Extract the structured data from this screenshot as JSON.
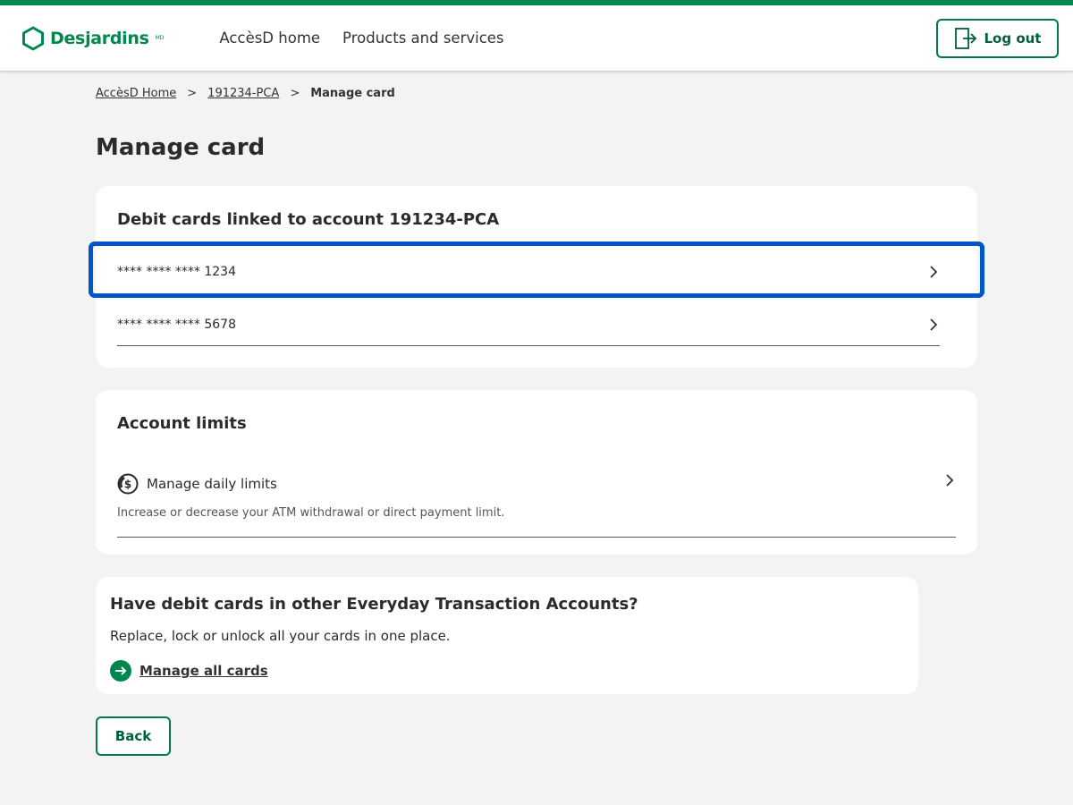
{
  "header": {
    "logo_text": "Desjardins",
    "logo_mark": "MD",
    "nav": [
      "AccèsD home",
      "Products and services"
    ],
    "logout_label": "Log out"
  },
  "breadcrumb": {
    "items": [
      "AccèsD Home",
      "191234-PCA"
    ],
    "current": "Manage card"
  },
  "page_title": "Manage card",
  "debit_cards": {
    "title": "Debit cards linked to account 191234-PCA",
    "cards": [
      "**** **** **** 1234",
      "**** **** **** 5678"
    ]
  },
  "account_limits": {
    "title": "Account limits",
    "item_label": "Manage daily limits",
    "item_desc": "Increase or decrease your ATM withdrawal or direct payment limit."
  },
  "other_accounts": {
    "title": "Have debit cards in other Everyday Transaction Accounts?",
    "desc": "Replace, lock or unlock all your cards in one place.",
    "link": "Manage all cards"
  },
  "back_label": "Back",
  "colors": {
    "brand_green": "#00874e",
    "focus_blue": "#0055c8"
  },
  "icons": {
    "logo": "desjardins-hexagon-icon",
    "logout": "logout-door-icon",
    "chevron": "chevron-right-icon",
    "dollar": "dollar-circle-icon",
    "arrow": "arrow-right-circle-icon"
  }
}
